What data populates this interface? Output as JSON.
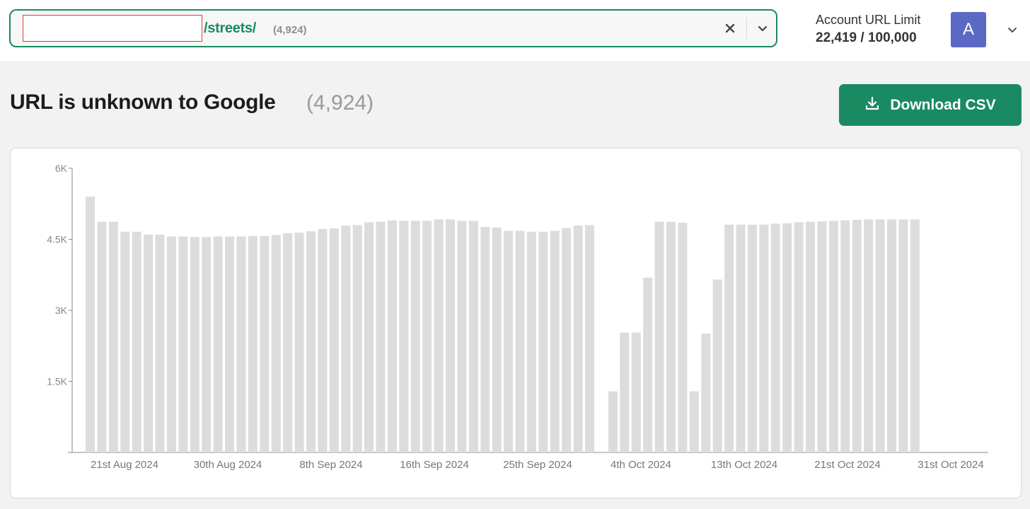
{
  "header": {
    "url_path": "/streets/",
    "url_count": "(4,924)",
    "account_limit_label": "Account URL Limit",
    "account_limit_value": "22,419 / 100,000",
    "avatar_initial": "A"
  },
  "colors": {
    "accent": "#1a8a62",
    "avatar": "#5b69c4",
    "bar": "#dcdcdc",
    "redaction_border": "#e53935"
  },
  "icons": {
    "clear": "close-icon",
    "url_dropdown": "chevron-down-icon",
    "account_dropdown": "chevron-down-icon",
    "download": "download-icon"
  },
  "page": {
    "title": "URL is unknown to Google",
    "count": "(4,924)",
    "download_label": "Download CSV"
  },
  "chart_data": {
    "type": "bar",
    "title": "",
    "xlabel": "",
    "ylabel": "",
    "ylim": [
      0,
      6000
    ],
    "yticks": [
      "1.5K",
      "3K",
      "4.5K",
      "6K"
    ],
    "xtick_labels": [
      "21st Aug 2024",
      "30th Aug 2024",
      "8th Sep 2024",
      "16th Sep 2024",
      "25th Sep 2024",
      "4th Oct 2024",
      "13th Oct 2024",
      "21st Oct 2024",
      "31st Oct 2024"
    ],
    "grid": false,
    "legend": "none",
    "values": [
      5400,
      4870,
      4870,
      4660,
      4660,
      4600,
      4600,
      4560,
      4560,
      4550,
      4550,
      4560,
      4560,
      4560,
      4570,
      4570,
      4590,
      4630,
      4640,
      4670,
      4720,
      4730,
      4790,
      4800,
      4860,
      4870,
      4900,
      4890,
      4890,
      4890,
      4920,
      4920,
      4890,
      4890,
      4760,
      4750,
      4680,
      4680,
      4660,
      4660,
      4680,
      4740,
      4790,
      4800,
      20,
      1290,
      2530,
      2530,
      3690,
      4870,
      4870,
      4850,
      1290,
      2510,
      3650,
      4810,
      4810,
      4810,
      4810,
      4830,
      4840,
      4860,
      4870,
      4880,
      4890,
      4900,
      4910,
      4920,
      4920,
      4920,
      4920,
      4920
    ]
  }
}
